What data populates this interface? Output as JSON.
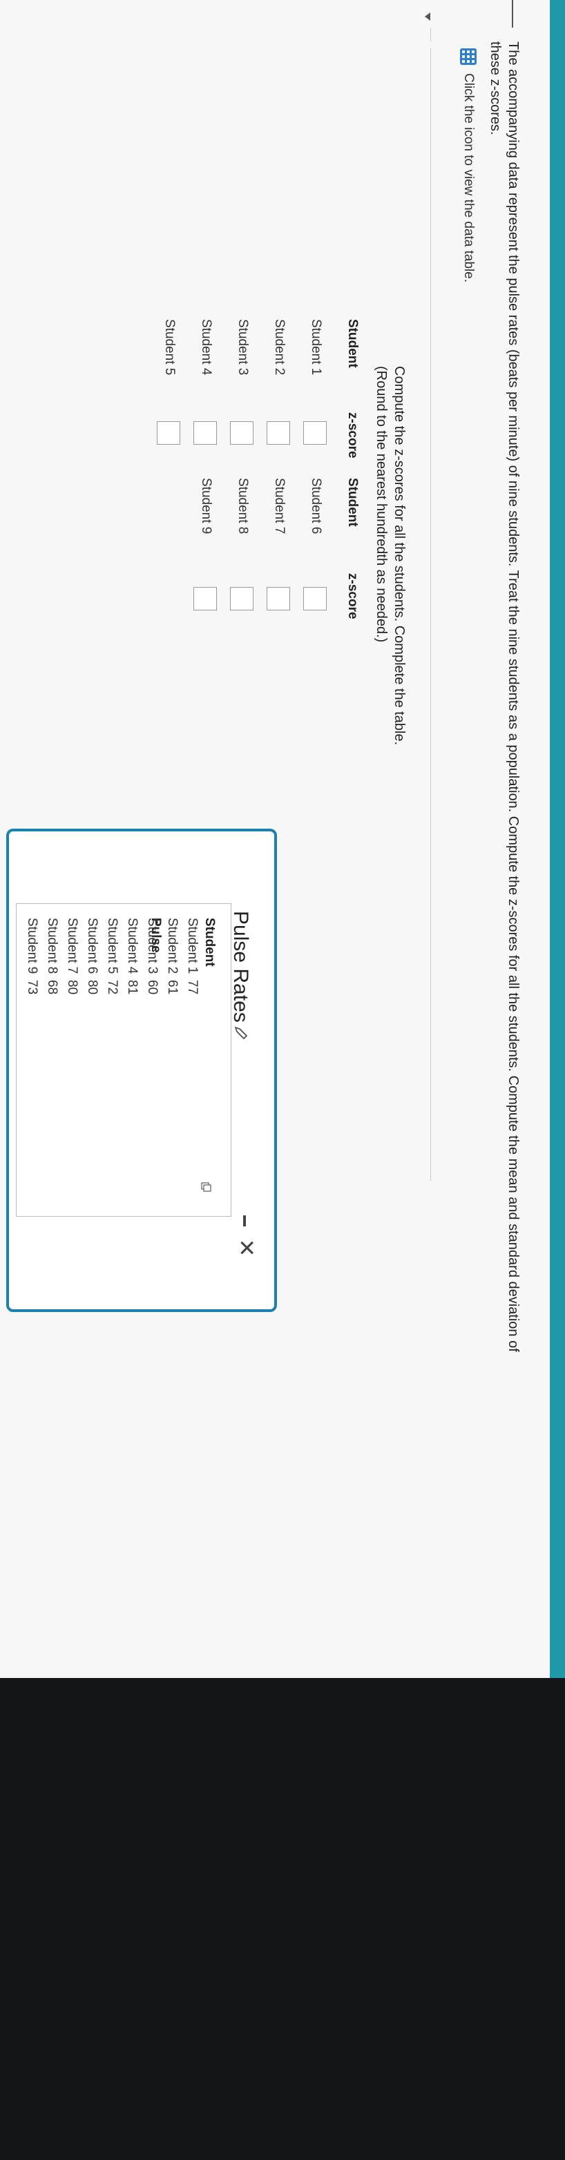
{
  "intro_text": "The accompanying data represent the pulse rates (beats per minute) of nine students. Treat the nine students as a population. Compute the z-scores for all the students. Compute the mean and standard deviation of these z-scores.",
  "view_data_label": "Click the icon to view the data table.",
  "instructions": {
    "line1": "Compute the z-scores for all the students. Complete the table.",
    "line2": "(Round to the nearest hundredth as needed.)"
  },
  "zscore_table": {
    "headers": {
      "student": "Student",
      "zscore": "z-score"
    },
    "left": [
      "Student 1",
      "Student 2",
      "Student 3",
      "Student 4",
      "Student 5"
    ],
    "right": [
      "Student 6",
      "Student 7",
      "Student 8",
      "Student 9"
    ]
  },
  "dialog": {
    "title": "Pulse Rates",
    "headers": {
      "student": "Student",
      "pulse": "Pulse"
    },
    "rows": [
      {
        "student": "Student 1",
        "pulse": "77"
      },
      {
        "student": "Student 2",
        "pulse": "61"
      },
      {
        "student": "Student 3",
        "pulse": "60"
      },
      {
        "student": "Student 4",
        "pulse": "81"
      },
      {
        "student": "Student 5",
        "pulse": "72"
      },
      {
        "student": "Student 6",
        "pulse": "80"
      },
      {
        "student": "Student 7",
        "pulse": "80"
      },
      {
        "student": "Student 8",
        "pulse": "68"
      },
      {
        "student": "Student 9",
        "pulse": "73"
      }
    ]
  },
  "colors": {
    "accent": "#1f98a8",
    "dialog_border": "#1b7fb0",
    "icon_blue": "#2a7fd1"
  }
}
